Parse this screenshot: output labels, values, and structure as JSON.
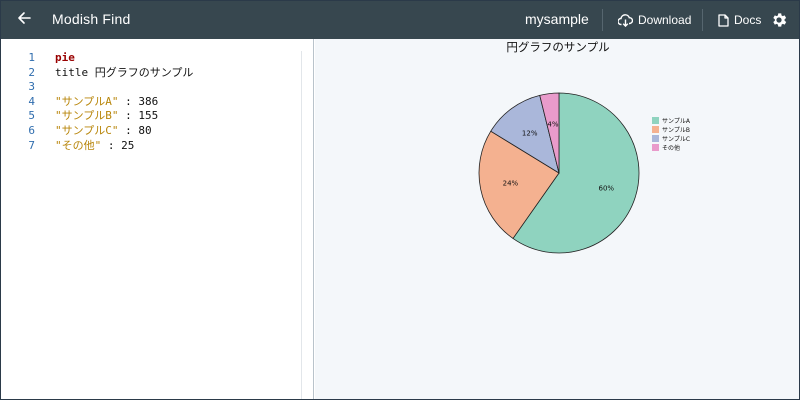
{
  "header": {
    "app_title": "Modish Find",
    "document_name": "mysample",
    "download_label": "Download",
    "docs_label": "Docs",
    "background": "#37474f"
  },
  "icons": {
    "back": "arrow-left-icon",
    "download": "cloud-download-icon",
    "docs": "document-icon",
    "settings": "gear-icon"
  },
  "editor": {
    "lines": [
      {
        "number": "1",
        "parts": [
          {
            "text": "pie",
            "type": "kw"
          }
        ]
      },
      {
        "number": "2",
        "parts": [
          {
            "text": "title 円グラフのサンプル",
            "type": "txt"
          }
        ]
      },
      {
        "number": "3",
        "parts": []
      },
      {
        "number": "4",
        "parts": [
          {
            "text": "\"サンプルA\"",
            "type": "str"
          },
          {
            "text": " : 386",
            "type": "txt"
          }
        ]
      },
      {
        "number": "5",
        "parts": [
          {
            "text": "\"サンプルB\"",
            "type": "str"
          },
          {
            "text": " : 155",
            "type": "txt"
          }
        ]
      },
      {
        "number": "6",
        "parts": [
          {
            "text": "\"サンプルC\"",
            "type": "str"
          },
          {
            "text": " : 80",
            "type": "txt"
          }
        ]
      },
      {
        "number": "7",
        "parts": [
          {
            "text": "\"その他\"",
            "type": "str"
          },
          {
            "text": " : 25",
            "type": "txt"
          }
        ]
      }
    ]
  },
  "chart_data": {
    "type": "pie",
    "title": "円グラフのサンプル",
    "categories": [
      "サンプルA",
      "サンプルB",
      "サンプルC",
      "その他"
    ],
    "values": [
      386,
      155,
      80,
      25
    ],
    "labels": [
      "60%",
      "24%",
      "12%",
      "4%"
    ],
    "colors": [
      "#8fd3bf",
      "#f4b190",
      "#aab7da",
      "#e99bcb"
    ],
    "stroke": "#222222",
    "legend": "right"
  }
}
